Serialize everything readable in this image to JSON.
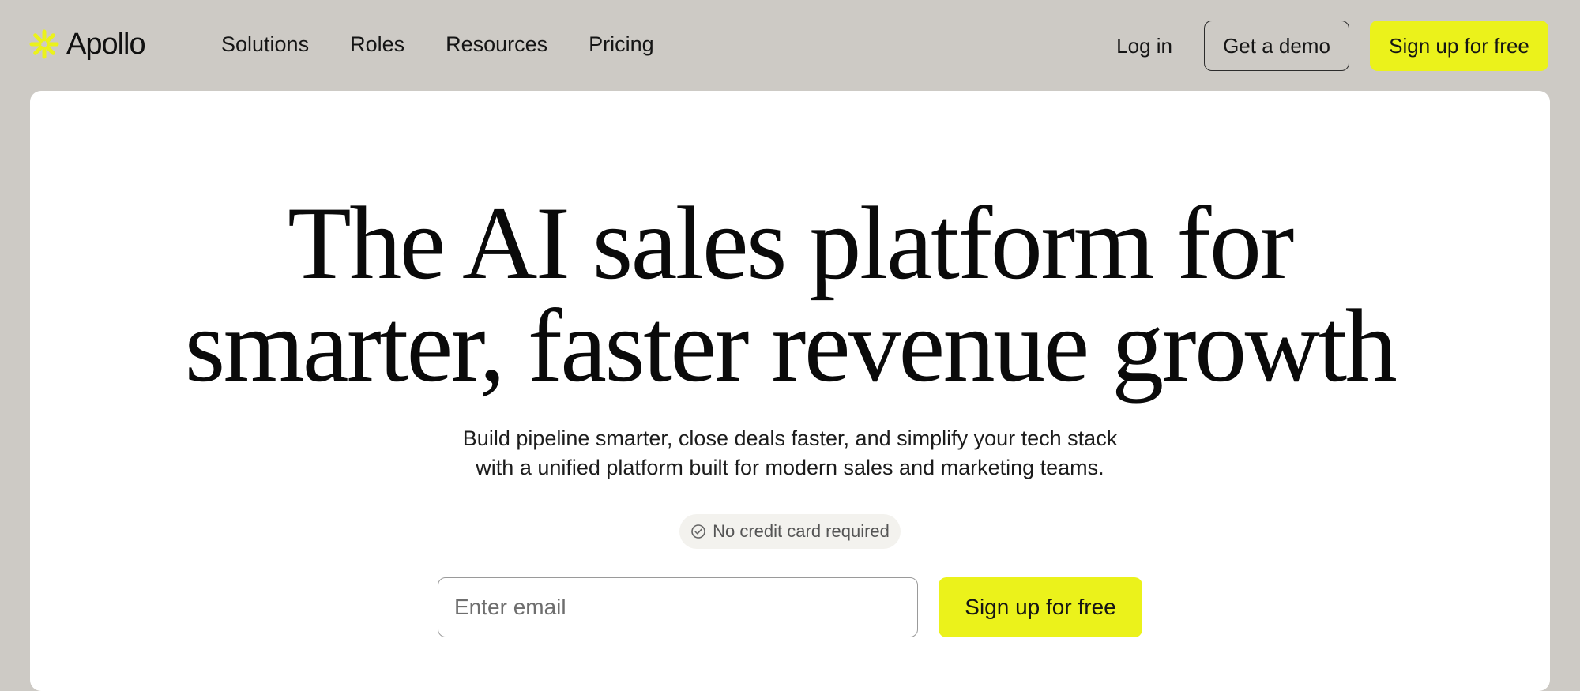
{
  "brand": {
    "name": "Apollo",
    "accent_color": "#ebf21b",
    "logo_icon": "apollo-sunburst-icon"
  },
  "nav": {
    "items": [
      {
        "label": "Solutions"
      },
      {
        "label": "Roles"
      },
      {
        "label": "Resources"
      },
      {
        "label": "Pricing"
      }
    ]
  },
  "header": {
    "login_label": "Log in",
    "demo_label": "Get a demo",
    "signup_label": "Sign up for free"
  },
  "hero": {
    "title_line1": "The AI sales platform for",
    "title_line2": "smarter, faster revenue growth",
    "subtitle_line1": "Build pipeline smarter, close deals faster, and simplify your tech stack",
    "subtitle_line2": "with a unified platform built for modern sales and marketing teams.",
    "badge_icon": "check-circle-icon",
    "badge_text": "No credit card required",
    "email_placeholder": "Enter email",
    "email_value": "",
    "signup_label": "Sign up for free"
  },
  "colors": {
    "page_background": "#cdcac5",
    "card_background": "#ffffff",
    "text": "#111111"
  }
}
